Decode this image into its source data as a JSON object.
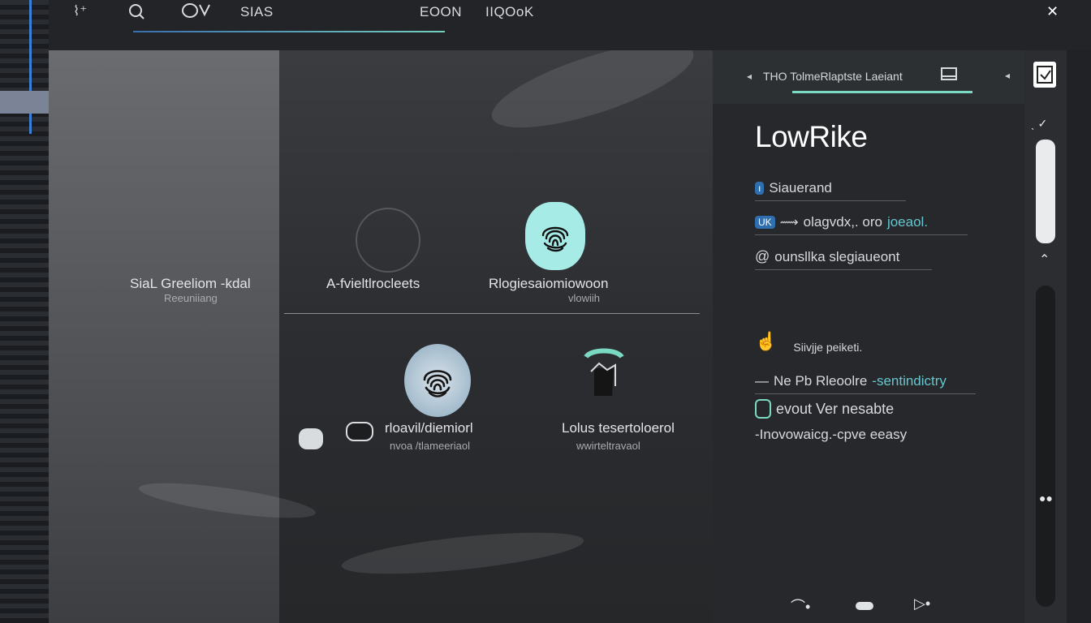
{
  "topbar": {
    "search_field_text": "SIAS",
    "tabs": [
      "EOON",
      "IIQOoK"
    ]
  },
  "stage": {
    "tiles": [
      {
        "label": "SiaL Greeliom  -kdal",
        "sub": "Reeuniiang"
      },
      {
        "label": "A-fvieltlrocleets",
        "sub": ""
      },
      {
        "label": "Rlogiesaiomiowoon",
        "sub": "vlowiih"
      },
      {
        "label": "rloavil/diemiorl",
        "sub": "nvoa /tlameeriaol"
      },
      {
        "label": "Lolus tesertoloerol",
        "sub": "wwirteltravaol"
      }
    ]
  },
  "panel": {
    "tab_text": "THO TolmeRlaptste Laeiant",
    "title": "LowRike",
    "items": [
      {
        "badge": "",
        "text": "Siauerand"
      },
      {
        "badge": "UK",
        "text": "olagvdx,. oro",
        "link": "joeaol."
      },
      {
        "badge": "",
        "text": "ounsllka slegiaueont"
      },
      {
        "badge": "",
        "text": "Siivjje peiketi."
      },
      {
        "badge": "",
        "text": "Ne Pb  Rleoolre",
        "link": "-sentindictry"
      },
      {
        "badge": "",
        "text": "evout Ver nesabte"
      },
      {
        "badge": "",
        "text": "-Inovowaicg.-cpve eeasy"
      }
    ]
  },
  "colors": {
    "accent_teal": "#79d9c2",
    "accent_blue": "#3c7fd6",
    "fingerprint_bg": "#a7ebe6"
  },
  "icons": [
    "search-icon",
    "close-icon",
    "fingerprint-icon",
    "hand-icon",
    "scroll-thumb"
  ]
}
